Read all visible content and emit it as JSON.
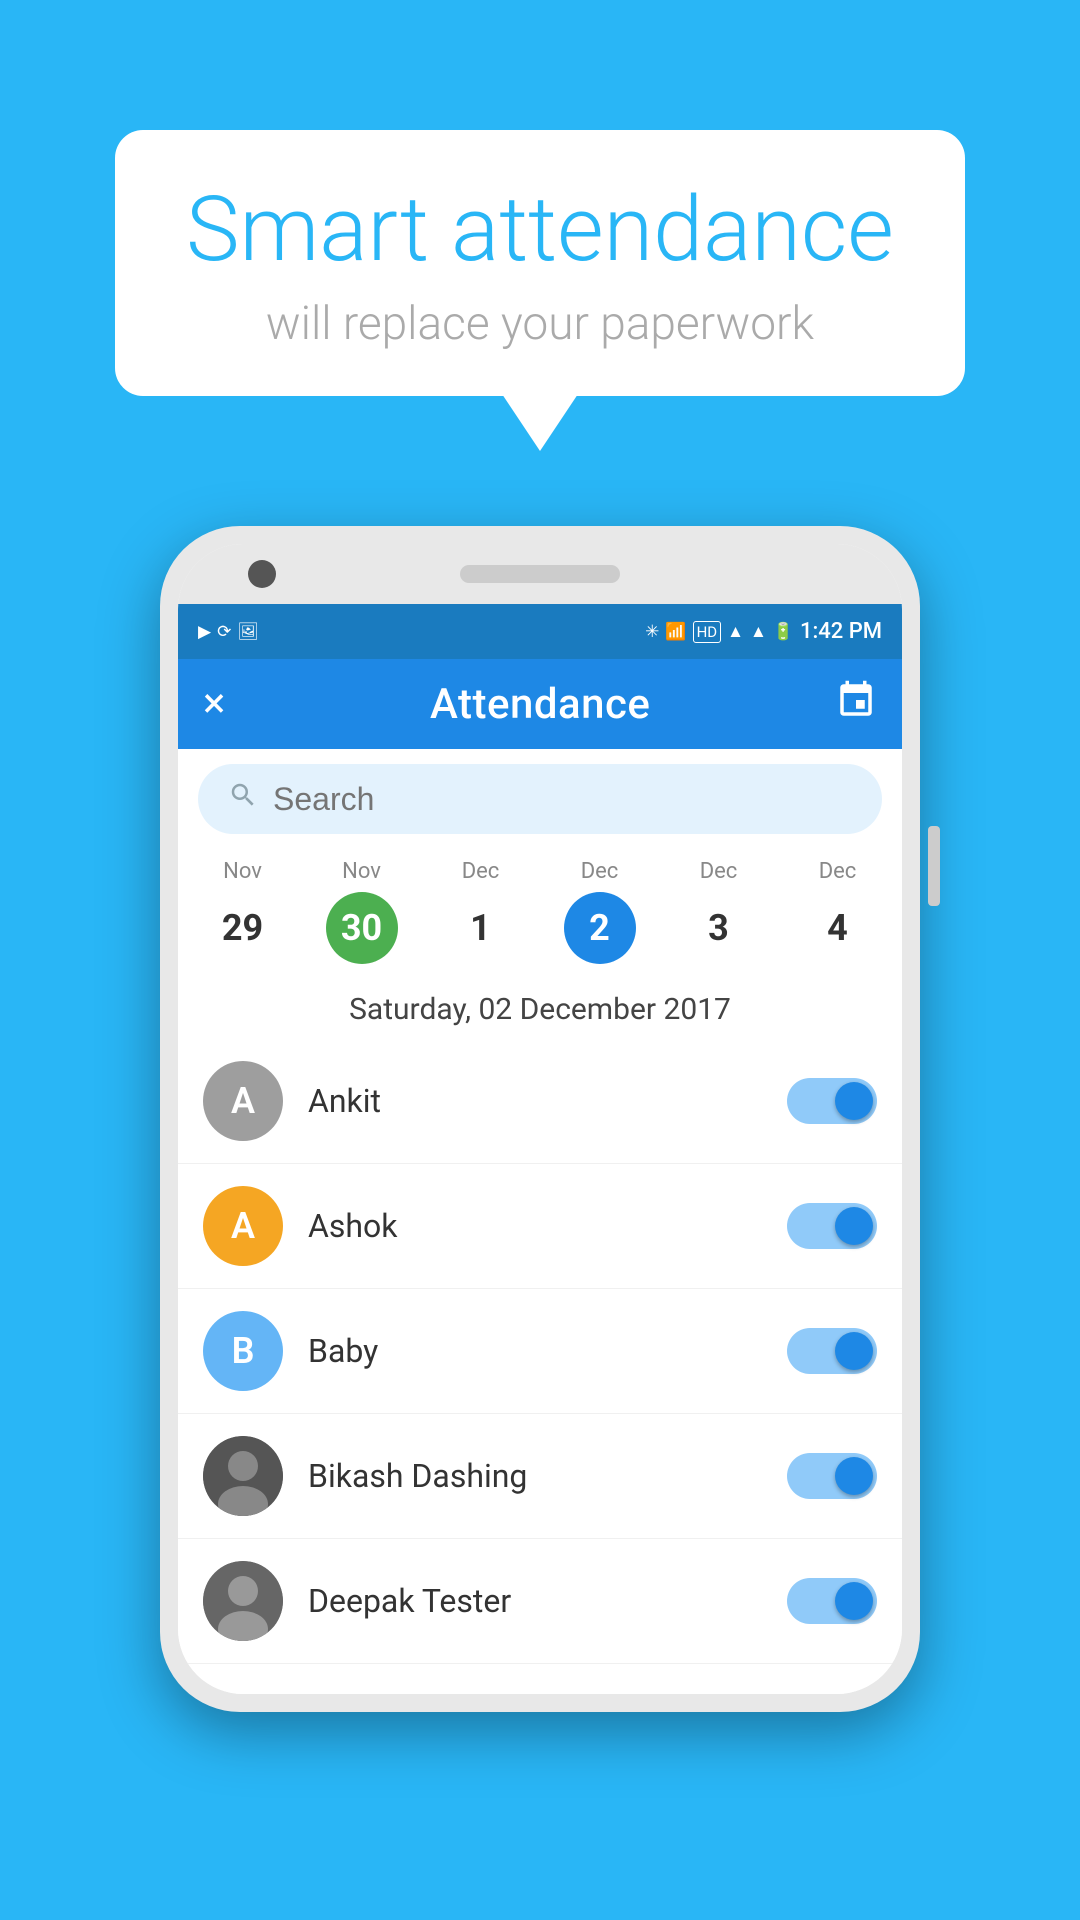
{
  "background_color": "#29b6f6",
  "bubble": {
    "heading": "Smart attendance",
    "subtext": "will replace your paperwork"
  },
  "status_bar": {
    "time": "1:42 PM",
    "icons_left": [
      "▶",
      "⟳",
      "🖼"
    ]
  },
  "toolbar": {
    "title": "Attendance",
    "close_label": "×",
    "calendar_icon": "📅"
  },
  "search": {
    "placeholder": "Search"
  },
  "dates": [
    {
      "month": "Nov",
      "day": "29",
      "style": "normal"
    },
    {
      "month": "Nov",
      "day": "30",
      "style": "green"
    },
    {
      "month": "Dec",
      "day": "1",
      "style": "normal"
    },
    {
      "month": "Dec",
      "day": "2",
      "style": "blue"
    },
    {
      "month": "Dec",
      "day": "3",
      "style": "normal"
    },
    {
      "month": "Dec",
      "day": "4",
      "style": "normal"
    }
  ],
  "selected_date_label": "Saturday, 02 December 2017",
  "students": [
    {
      "name": "Ankit",
      "initial": "A",
      "avatar_color": "gray",
      "present": true,
      "has_photo": false
    },
    {
      "name": "Ashok",
      "initial": "A",
      "avatar_color": "orange",
      "present": true,
      "has_photo": false
    },
    {
      "name": "Baby",
      "initial": "B",
      "avatar_color": "light-blue",
      "present": true,
      "has_photo": false
    },
    {
      "name": "Bikash Dashing",
      "initial": "",
      "avatar_color": "photo",
      "present": true,
      "has_photo": true
    },
    {
      "name": "Deepak Tester",
      "initial": "",
      "avatar_color": "photo",
      "present": true,
      "has_photo": true
    }
  ]
}
